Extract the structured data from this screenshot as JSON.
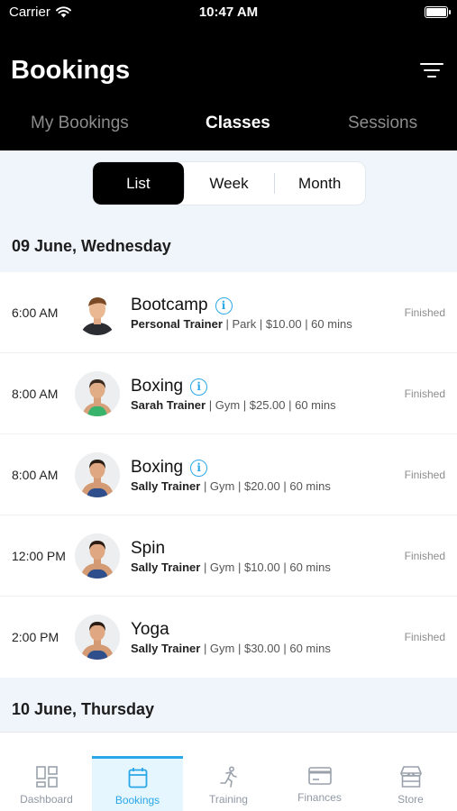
{
  "status_bar": {
    "carrier": "Carrier",
    "time": "10:47 AM"
  },
  "header": {
    "title": "Bookings"
  },
  "top_tabs": [
    {
      "label": "My Bookings",
      "active": false
    },
    {
      "label": "Classes",
      "active": true
    },
    {
      "label": "Sessions",
      "active": false
    }
  ],
  "view_toggle": {
    "options": [
      "List",
      "Week",
      "Month"
    ],
    "selected": "List"
  },
  "days": [
    {
      "date": "09 June, Wednesday",
      "classes": [
        {
          "time": "6:00 AM",
          "name": "Bootcamp",
          "has_info": true,
          "trainer": "Personal Trainer",
          "details": " | Park | $10.00 | 60 mins",
          "status": "Finished",
          "avatar": "male"
        },
        {
          "time": "8:00 AM",
          "name": "Boxing",
          "has_info": true,
          "trainer": "Sarah Trainer",
          "details": " | Gym | $25.00 | 60 mins",
          "status": "Finished",
          "avatar": "female-green"
        },
        {
          "time": "8:00 AM",
          "name": "Boxing",
          "has_info": true,
          "trainer": "Sally Trainer",
          "details": " | Gym | $20.00 | 60 mins",
          "status": "Finished",
          "avatar": "female-blue"
        },
        {
          "time": "12:00 PM",
          "name": "Spin",
          "has_info": false,
          "trainer": "Sally Trainer",
          "details": " | Gym | $10.00 | 60 mins",
          "status": "Finished",
          "avatar": "female-blue"
        },
        {
          "time": "2:00 PM",
          "name": "Yoga",
          "has_info": false,
          "trainer": "Sally Trainer",
          "details": " | Gym | $30.00 | 60 mins",
          "status": "Finished",
          "avatar": "female-blue"
        }
      ]
    },
    {
      "date": "10 June, Thursday",
      "classes": []
    }
  ],
  "bottom_nav": [
    {
      "label": "Dashboard",
      "icon": "dashboard-icon",
      "active": false
    },
    {
      "label": "Bookings",
      "icon": "calendar-icon",
      "active": true
    },
    {
      "label": "Training",
      "icon": "running-icon",
      "active": false
    },
    {
      "label": "Finances",
      "icon": "credit-card-icon",
      "active": false
    },
    {
      "label": "Store",
      "icon": "store-icon",
      "active": false
    }
  ],
  "colors": {
    "accent": "#2aa7e8",
    "header_bg": "#000000",
    "page_bg": "#f0f5fc"
  }
}
